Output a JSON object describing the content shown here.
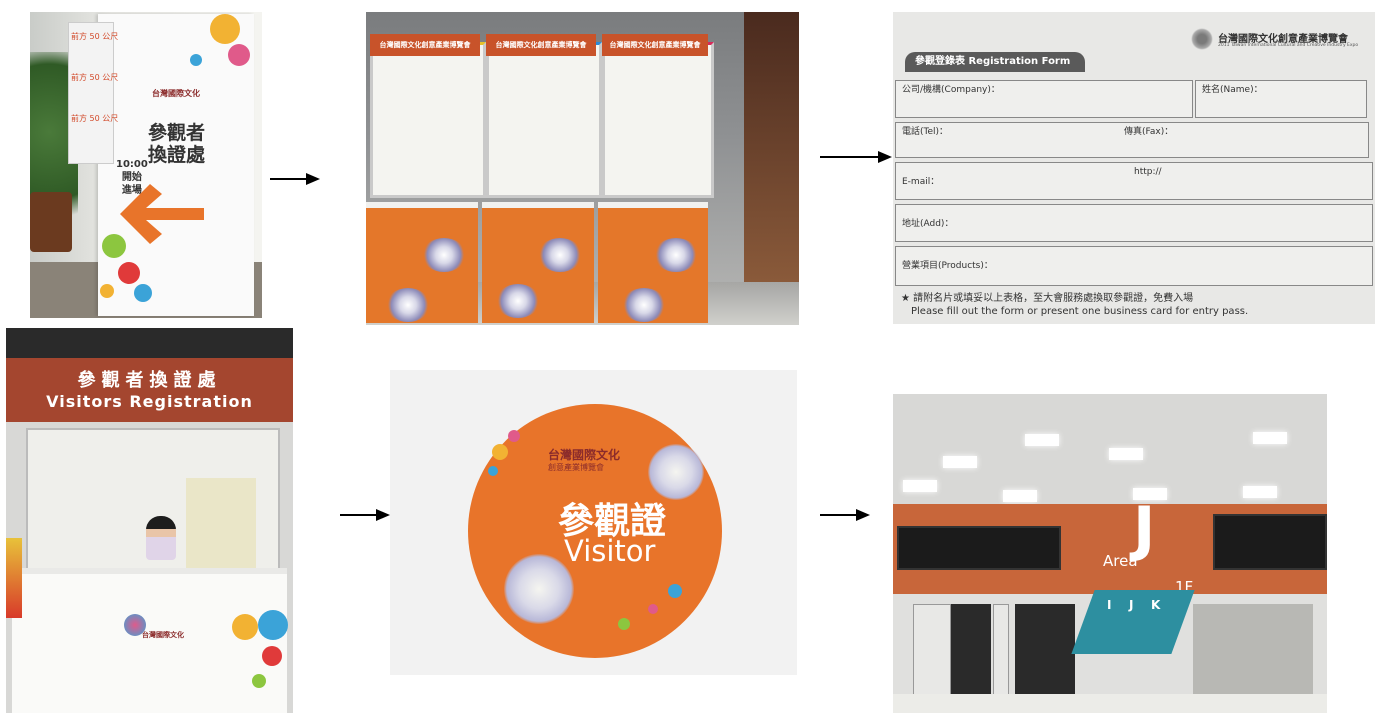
{
  "photo1": {
    "notes": [
      "前方 50 公尺",
      "前方 50 公尺",
      "前方 50 公尺"
    ],
    "time_lines": [
      "10:00",
      "開始",
      "進場"
    ],
    "sign_title": [
      "參觀者",
      "換證處"
    ],
    "logo_text": "台灣國際文化"
  },
  "photo2": {
    "header": "台灣國際文化創意產業博覽會"
  },
  "photo3": {
    "form_title": "參觀登錄表 Registration Form",
    "brand": "台灣國際文化創意產業博覽會",
    "brand_sub": "2011 Taiwan International Cultural and Creative Industry Expo",
    "company": "公司/機構(Company)：",
    "name": "姓名(Name)：",
    "tel": "電話(Tel)：",
    "fax": "傳真(Fax)：",
    "email": "E-mail：",
    "http": "http://",
    "address": "地址(Add)：",
    "products": "營業項目(Products)：",
    "note_zh": "★ 請附名片或填妥以上表格，至大會服務處換取參觀證，免費入場",
    "note_en": "Please fill out the form or present one  business card for entry pass."
  },
  "photo4": {
    "banner_zh": "參觀者換證處",
    "banner_en": "Visitors Registration",
    "logo_text": "台灣國際文化"
  },
  "photo5": {
    "logo_zh": "台灣國際文化",
    "logo_zh2": "創意產業博覽會",
    "title_zh": "參觀證",
    "title_en": "Visitor"
  },
  "photo6": {
    "area": "Area",
    "area_letter": "J",
    "floor": "1F",
    "map_labels": [
      "I",
      "J",
      "K"
    ]
  },
  "colors": {
    "orange": "#e8742a",
    "brick": "#a4462f",
    "arrow": "#000000"
  }
}
